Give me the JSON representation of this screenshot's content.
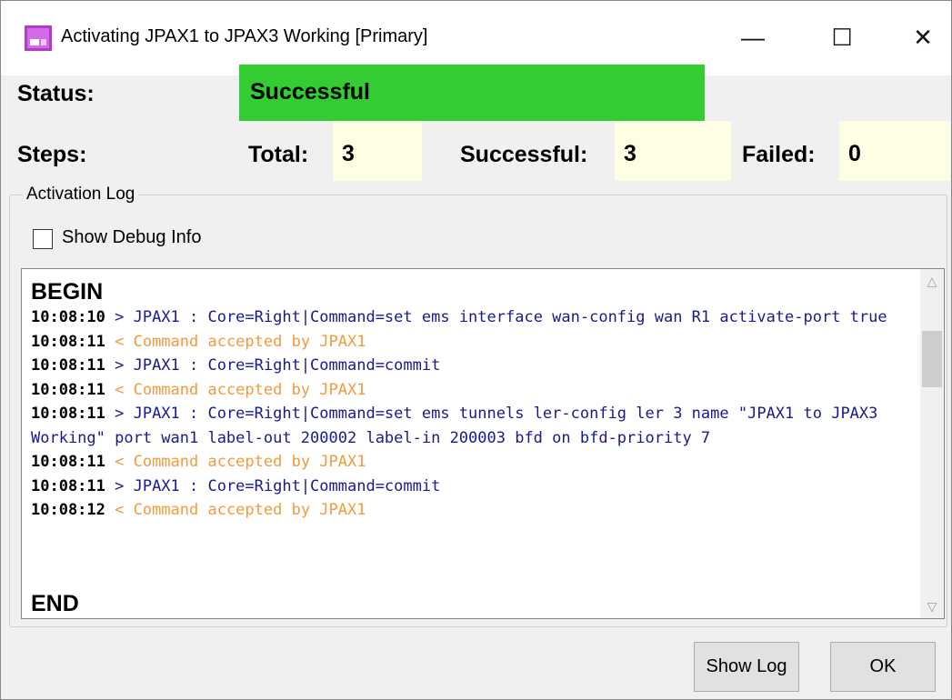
{
  "window": {
    "title": "Activating JPAX1 to JPAX3 Working  [Primary]",
    "icon": "app-icon",
    "controls": {
      "minimize": "—",
      "maximize": "☐",
      "close": "✕"
    }
  },
  "status": {
    "label": "Status:",
    "value": "Successful",
    "color": "#33cc33"
  },
  "steps": {
    "label": "Steps:",
    "total_label": "Total:",
    "total_value": "3",
    "successful_label": "Successful:",
    "successful_value": "3",
    "failed_label": "Failed:",
    "failed_value": "0"
  },
  "activation_log": {
    "group_title": "Activation Log",
    "debug_checkbox_label": "Show Debug Info",
    "debug_checked": false,
    "begin": "BEGIN",
    "end": "END",
    "entries": [
      {
        "time": "10:08:10",
        "text": " > JPAX1 : Core=Right|Command=set ems interface wan-config wan R1 activate-port true",
        "kind": "sent"
      },
      {
        "time": "10:08:11",
        "text": " < Command accepted by JPAX1",
        "kind": "recv"
      },
      {
        "time": "10:08:11",
        "text": " > JPAX1 : Core=Right|Command=commit",
        "kind": "sent"
      },
      {
        "time": "10:08:11",
        "text": " < Command accepted by JPAX1",
        "kind": "recv"
      },
      {
        "time": "10:08:11",
        "text": " > JPAX1 : Core=Right|Command=set ems tunnels ler-config ler 3 name \"JPAX1 to JPAX3 Working\" port wan1 label-out 200002 label-in 200003 bfd on bfd-priority 7",
        "kind": "sent"
      },
      {
        "time": "10:08:11",
        "text": " < Command accepted by JPAX1",
        "kind": "recv"
      },
      {
        "time": "10:08:11",
        "text": " > JPAX1 : Core=Right|Command=commit",
        "kind": "sent"
      },
      {
        "time": "10:08:12",
        "text": " < Command accepted by JPAX1",
        "kind": "recv"
      }
    ]
  },
  "buttons": {
    "show_log": "Show Log",
    "ok": "OK"
  },
  "colors": {
    "sent": "#1a1a8c",
    "received": "#f29a3d",
    "count_background": "#fefee5"
  }
}
